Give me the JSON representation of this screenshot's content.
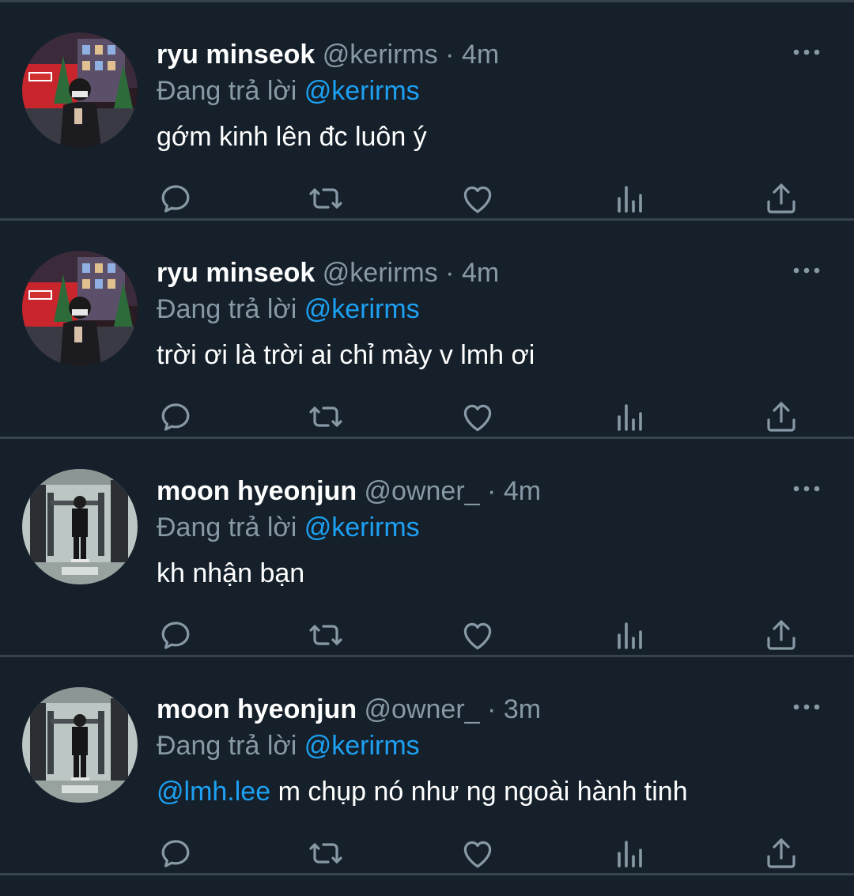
{
  "tweets": [
    {
      "display_name": "ryu minseok",
      "handle": "@kerirms",
      "separator": "·",
      "time": "4m",
      "reply_prefix": "Đang trả lời",
      "reply_target": "@kerirms",
      "mention": "",
      "text": "gớm kinh lên đc luôn ý",
      "avatar": "city-night-portrait"
    },
    {
      "display_name": "ryu minseok",
      "handle": "@kerirms",
      "separator": "·",
      "time": "4m",
      "reply_prefix": "Đang trả lời",
      "reply_target": "@kerirms",
      "mention": "",
      "text": "trời ơi là trời ai chỉ mày v lmh ơi",
      "avatar": "city-night-portrait"
    },
    {
      "display_name": "moon hyeonjun",
      "handle": "@owner_",
      "separator": "·",
      "time": "4m",
      "reply_prefix": "Đang trả lời",
      "reply_target": "@kerirms",
      "mention": "",
      "text": "kh nhận bạn",
      "avatar": "gym-mirror-selfie"
    },
    {
      "display_name": "moon hyeonjun",
      "handle": "@owner_",
      "separator": "·",
      "time": "3m",
      "reply_prefix": "Đang trả lời",
      "reply_target": "@kerirms",
      "mention": "@lmh.lee",
      "text": "m chụp nó như ng ngoài hành tinh",
      "avatar": "gym-mirror-selfie"
    }
  ],
  "icons": {
    "reply": "reply-icon",
    "retweet": "retweet-icon",
    "like": "heart-icon",
    "analytics": "analytics-icon",
    "share": "share-icon",
    "more": "more-icon"
  },
  "colors": {
    "background": "#15202b",
    "divider": "#38444d",
    "secondary_text": "#8899a6",
    "accent": "#1da1f2"
  }
}
